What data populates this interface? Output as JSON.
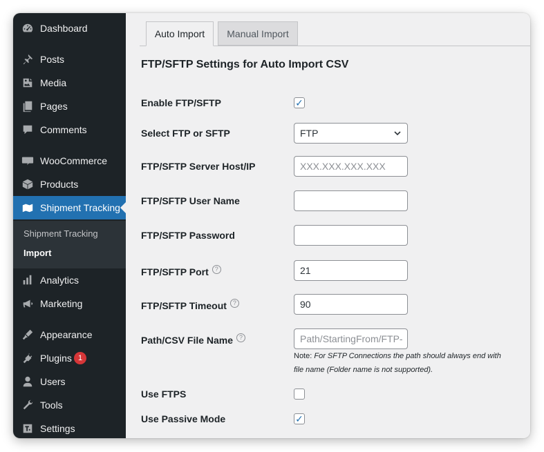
{
  "sidebar": {
    "items": [
      {
        "label": "Dashboard",
        "icon": "dashboard-icon"
      },
      {
        "label": "Posts",
        "icon": "pin-icon"
      },
      {
        "label": "Media",
        "icon": "media-icon"
      },
      {
        "label": "Pages",
        "icon": "pages-icon"
      },
      {
        "label": "Comments",
        "icon": "comment-icon"
      },
      {
        "label": "WooCommerce",
        "icon": "woocommerce-icon"
      },
      {
        "label": "Products",
        "icon": "box-icon"
      },
      {
        "label": "Shipment Tracking",
        "icon": "map-icon"
      },
      {
        "label": "Analytics",
        "icon": "bar-chart-icon"
      },
      {
        "label": "Marketing",
        "icon": "megaphone-icon"
      },
      {
        "label": "Appearance",
        "icon": "brush-icon"
      },
      {
        "label": "Plugins",
        "icon": "plugin-icon"
      },
      {
        "label": "Users",
        "icon": "user-icon"
      },
      {
        "label": "Tools",
        "icon": "wrench-icon"
      },
      {
        "label": "Settings",
        "icon": "settings-icon"
      }
    ],
    "submenu": [
      "Shipment Tracking",
      "Import"
    ],
    "plugins_badge": "1",
    "accent_color": "#2271b1"
  },
  "tabs": [
    "Auto Import",
    "Manual Import"
  ],
  "section_title": "FTP/SFTP Settings for Auto Import CSV",
  "fields": {
    "enable": {
      "label": "Enable FTP/SFTP",
      "checked": true
    },
    "type": {
      "label": "Select FTP or SFTP",
      "value": "FTP"
    },
    "host": {
      "label": "FTP/SFTP Server Host/IP",
      "placeholder": "XXX.XXX.XXX.XXX"
    },
    "user": {
      "label": "FTP/SFTP User Name",
      "value": ""
    },
    "password": {
      "label": "FTP/SFTP Password",
      "value": ""
    },
    "port": {
      "label": "FTP/SFTP Port",
      "value": "21"
    },
    "timeout": {
      "label": "FTP/SFTP Timeout",
      "value": "90"
    },
    "path": {
      "label": "Path/CSV File Name",
      "placeholder": "Path/StartingFrom/FTP-"
    },
    "note_prefix": "Note:",
    "note_line1": "For SFTP Connections the path should always end with",
    "note_line2": "file name (Folder name is not supported).",
    "ftps": {
      "label": "Use FTPS",
      "checked": false
    },
    "passive": {
      "label": "Use Passive Mode",
      "checked": true
    }
  }
}
